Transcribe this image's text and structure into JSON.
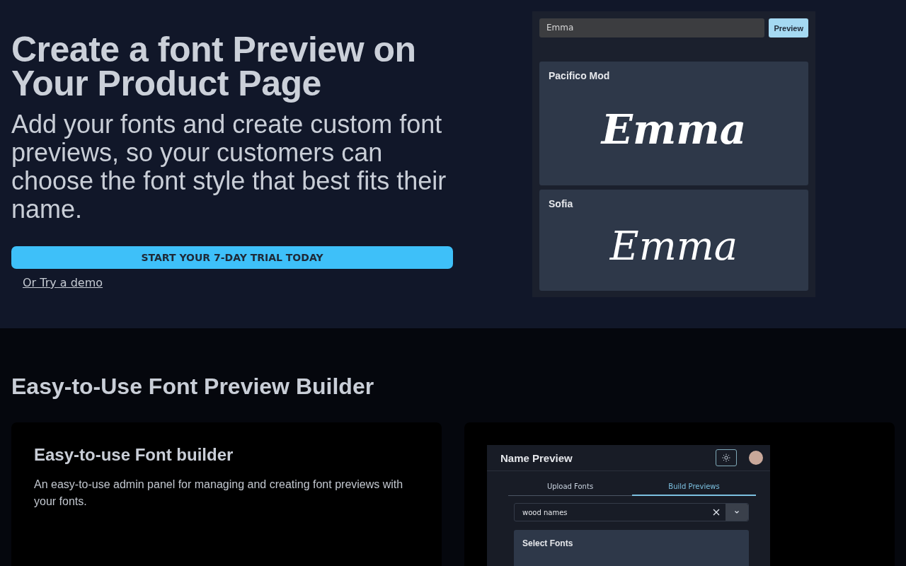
{
  "hero": {
    "title": "Create a font Preview on Your Product Page",
    "subtitle": "Add your fonts and create custom font previews, so your customers can choose the font style that best fits their name.",
    "cta": "START YOUR 7-DAY TRIAL TODAY",
    "demo_link": "Or Try a demo"
  },
  "preview_widget": {
    "name_input": "Emma",
    "button": "Preview",
    "previews": [
      {
        "font": "Pacifico Mod",
        "sample": "Emma",
        "kind": "bold-script"
      },
      {
        "font": "Sofia",
        "sample": "Emma",
        "kind": "thin-script"
      }
    ]
  },
  "features": {
    "heading": "Easy-to-Use Font Preview Builder",
    "card": {
      "title": "Easy-to-use Font builder",
      "text": "An easy-to-use admin panel for managing and creating font previews with your fonts."
    },
    "admin": {
      "title": "Name Preview",
      "tabs": [
        {
          "label": "Upload Fonts",
          "selected": false
        },
        {
          "label": "Build Previews",
          "selected": true
        }
      ],
      "select_value": "wood names",
      "panel_title": "Select Fonts"
    }
  }
}
